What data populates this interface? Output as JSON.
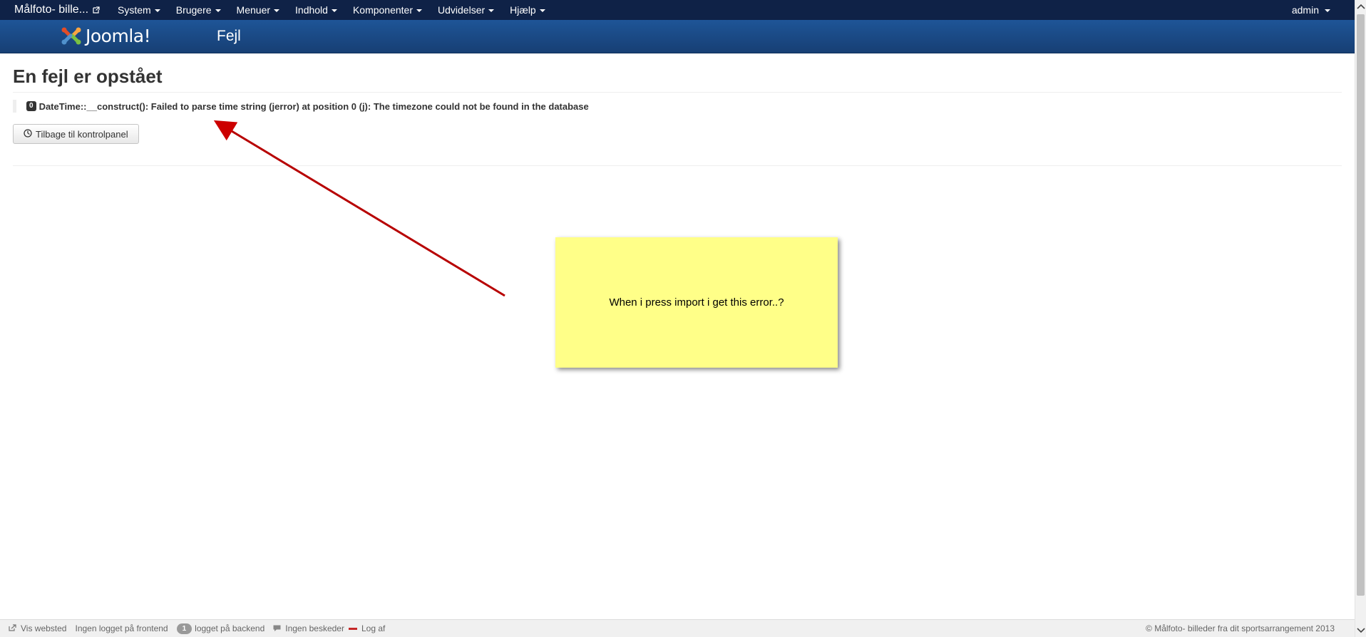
{
  "navbar": {
    "brand": "Målfoto- bille...",
    "menu": [
      {
        "label": "System"
      },
      {
        "label": "Brugere"
      },
      {
        "label": "Menuer"
      },
      {
        "label": "Indhold"
      },
      {
        "label": "Komponenter"
      },
      {
        "label": "Udvidelser"
      },
      {
        "label": "Hjælp"
      }
    ],
    "user": "admin"
  },
  "header": {
    "logo_text": "Joomla!",
    "page_title": "Fejl"
  },
  "error": {
    "heading": "En fejl er opstået",
    "code": "0",
    "message": "DateTime::__construct(): Failed to parse time string (jerror) at position 0 (j): The timezone could not be found in the database",
    "back_button": "Tilbage til kontrolpanel"
  },
  "annotation": {
    "note_text": "When i press import i get this error..?",
    "color": "#ffff88",
    "arrow_color": "#cc0000"
  },
  "footer": {
    "view_site": "Vis websted",
    "frontend": "Ingen logget på frontend",
    "backend_count": "1",
    "backend": "logget på backend",
    "messages": "Ingen beskeder",
    "logout": "Log af",
    "copyright": "© Målfoto- billeder fra dit sportsarrangement 2013"
  },
  "colors": {
    "navbar": "#0f2247",
    "header": "#1e5597"
  }
}
